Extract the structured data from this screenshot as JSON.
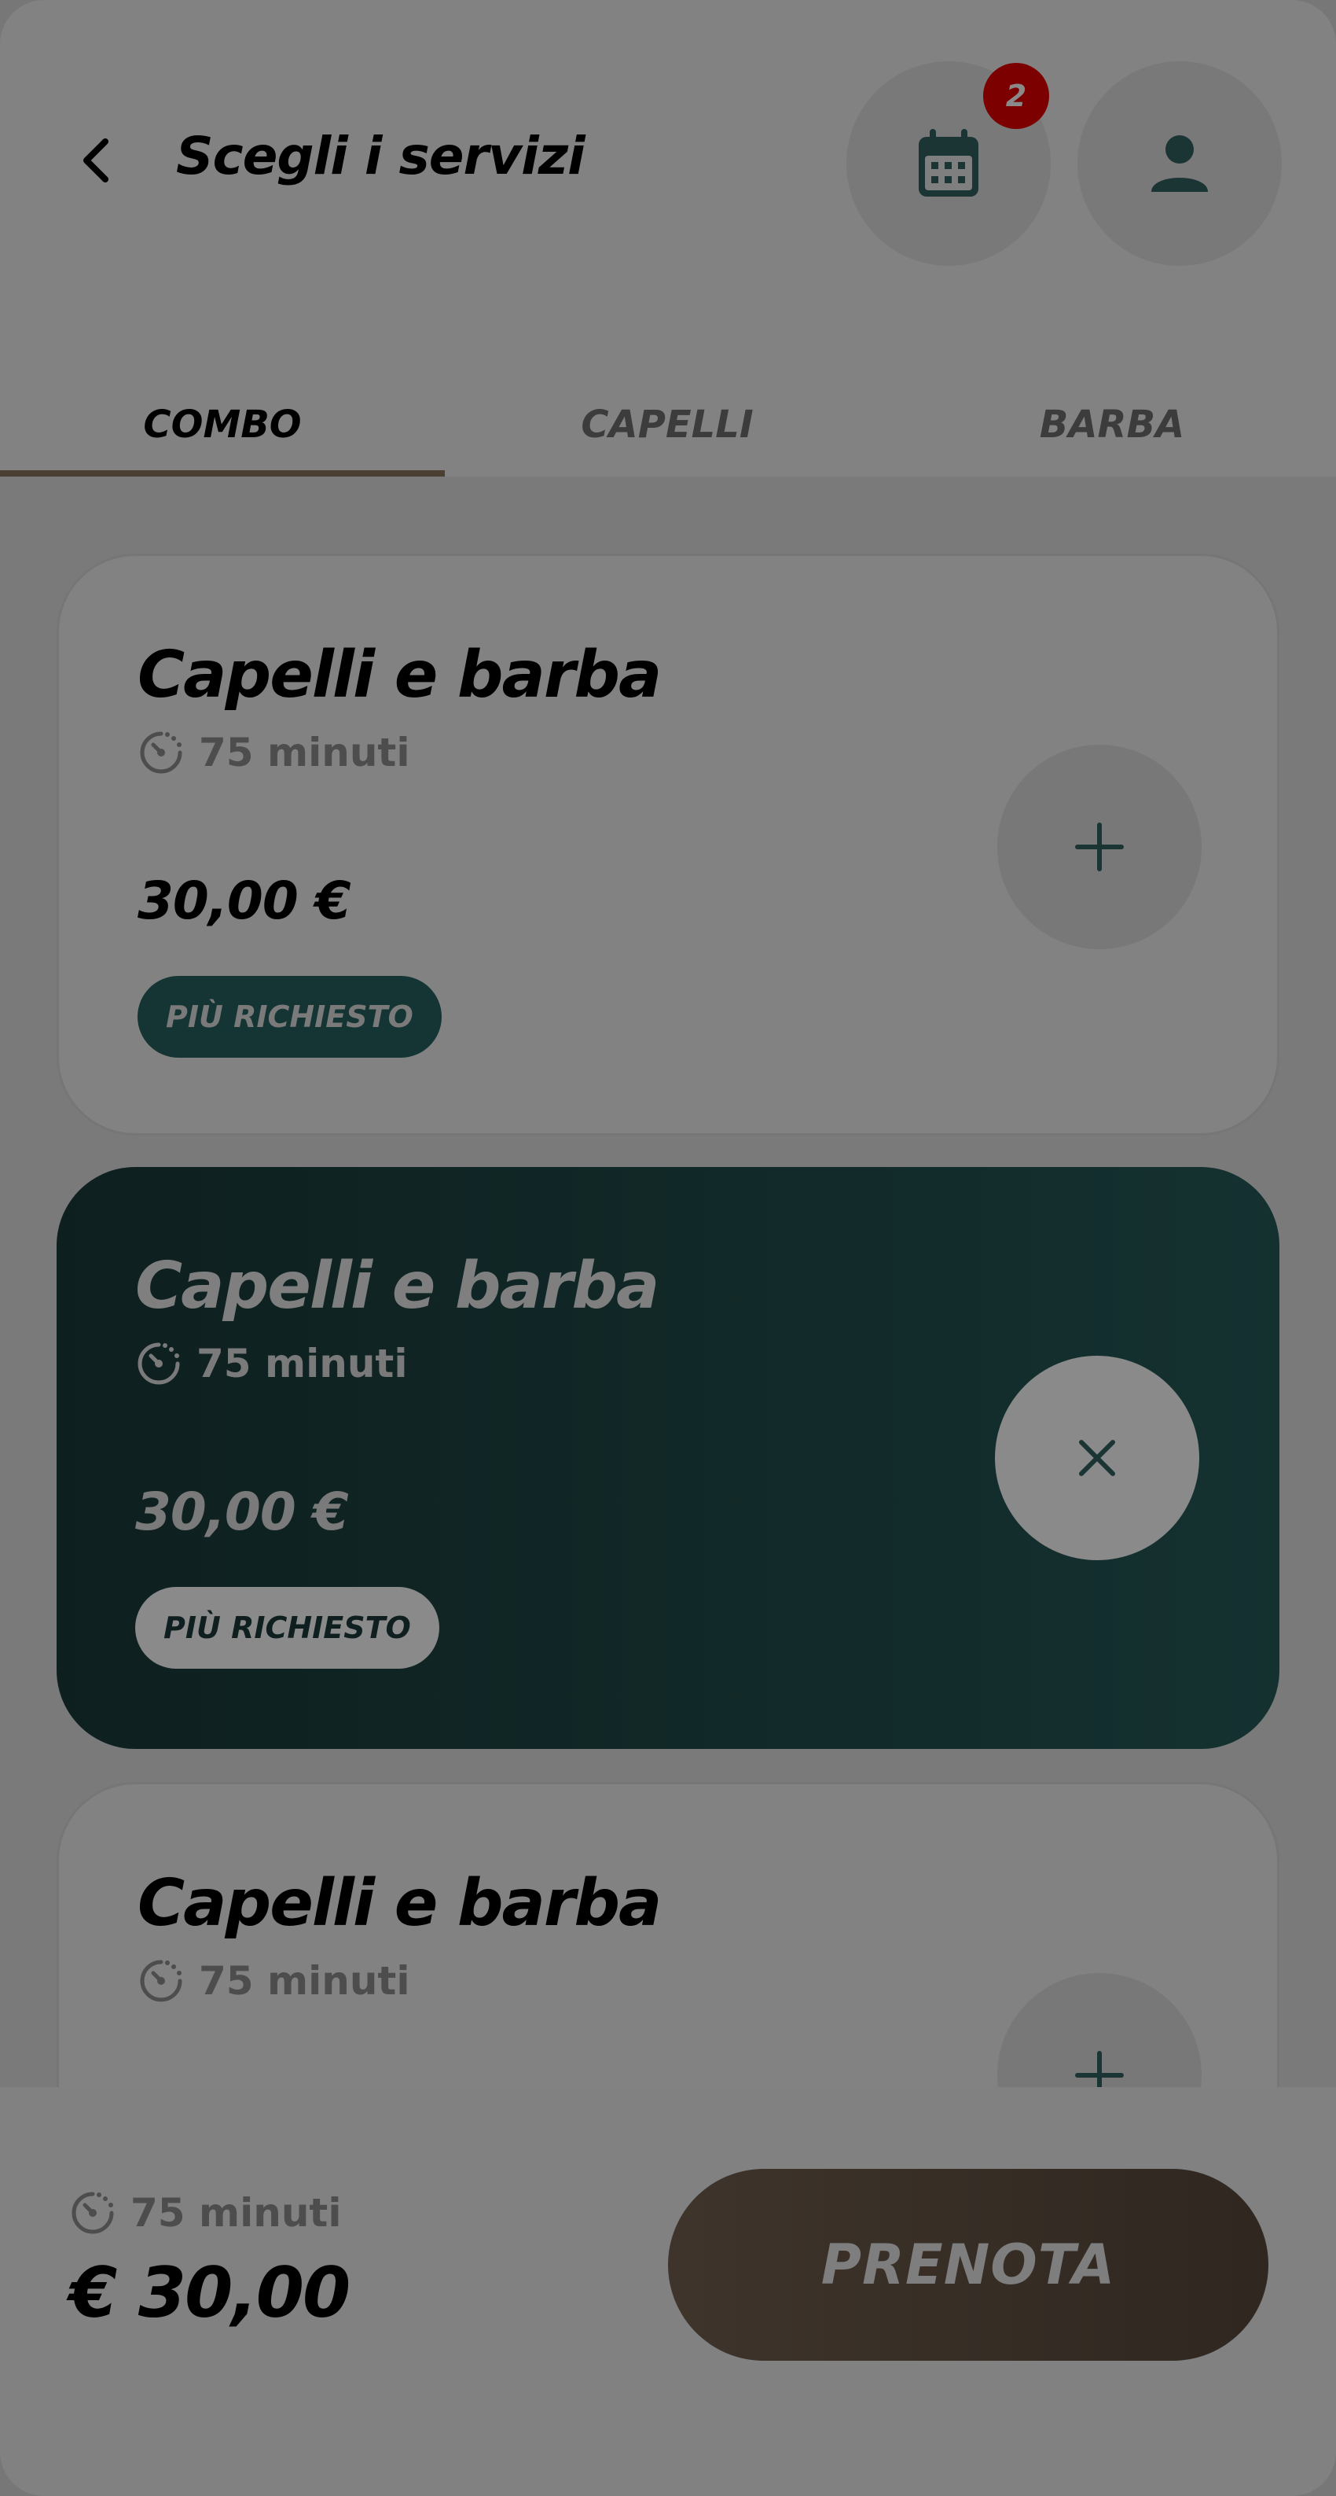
{
  "header": {
    "title": "Scegli i servizi",
    "notification_count": "2",
    "icons": {
      "back": "chevron-left-icon",
      "calendar": "calendar-icon",
      "user": "user-icon"
    }
  },
  "tabs": [
    {
      "label": "COMBO",
      "active": true
    },
    {
      "label": "CAPELLI",
      "active": false
    },
    {
      "label": "BARBA",
      "active": false
    }
  ],
  "services": [
    {
      "title": "Capelli e barba",
      "duration": "75 minuti",
      "price": "30,00 €",
      "tag": "PIÙ RICHIESTO",
      "selected": false,
      "action_icon": "plus-icon"
    },
    {
      "title": "Capelli e barba",
      "duration": "75 minuti",
      "price": "30,00 €",
      "tag": "PIÙ RICHIESTO",
      "selected": true,
      "action_icon": "close-icon"
    },
    {
      "title": "Capelli e barba",
      "duration": "75 minuti",
      "selected": false,
      "action_icon": "plus-icon"
    }
  ],
  "summary": {
    "duration": "75 minuti",
    "total": "€ 30,00",
    "book_label": "PRENOTA"
  },
  "colors": {
    "accent_dark_teal": "#143534",
    "brown_button": "#3e342b",
    "badge_red": "#7c0000"
  }
}
